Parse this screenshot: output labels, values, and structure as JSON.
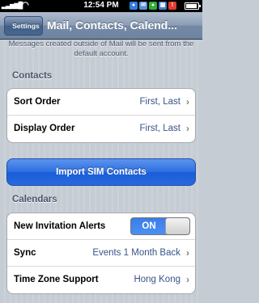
{
  "status_bar": {
    "time": "12:54 PM",
    "carrier_icon": "signal-bars-icon",
    "wifi_icon": "wifi-icon",
    "notification_icons": [
      "chat-bubble-icon",
      "mail-icon",
      "messages-icon",
      "calendar-icon",
      "alert-icon"
    ],
    "battery_level": 0.9
  },
  "nav": {
    "back_label": "Settings",
    "title": "Mail, Contacts, Calend..."
  },
  "footer_note": "Messages created outside of Mail will be sent from the default account.",
  "contacts": {
    "header": "Contacts",
    "rows": [
      {
        "label": "Sort Order",
        "value": "First, Last"
      },
      {
        "label": "Display Order",
        "value": "First, Last"
      }
    ],
    "import_label": "Import SIM Contacts"
  },
  "calendars": {
    "header": "Calendars",
    "invitation": {
      "label": "New Invitation Alerts",
      "toggle": "ON"
    },
    "rows": [
      {
        "label": "Sync",
        "value": "Events 1 Month Back"
      },
      {
        "label": "Time Zone Support",
        "value": "Hong Kong"
      }
    ]
  },
  "colors": {
    "accent_blue": "#2a68dc",
    "value_text": "#385487",
    "background": "#c5ccd4"
  }
}
